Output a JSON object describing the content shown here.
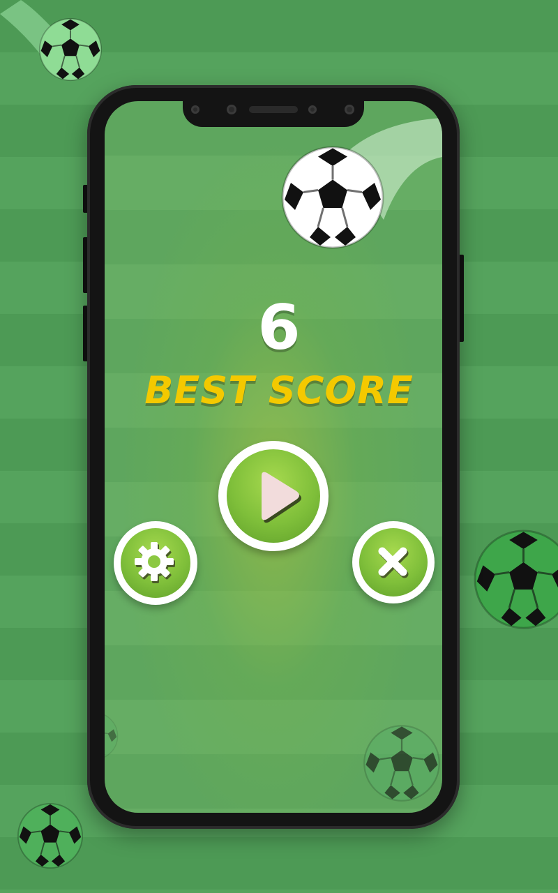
{
  "game": {
    "score": "6",
    "best_score_label": "BEST SCORE"
  },
  "buttons": {
    "play": "play",
    "settings": "settings",
    "close": "close"
  },
  "colors": {
    "field_green": "#4d9a55",
    "accent_yellow": "#f4c900",
    "button_green": "#7fbf3a"
  },
  "icons": [
    "play-icon",
    "gear-icon",
    "close-icon",
    "soccer-ball-icon"
  ]
}
